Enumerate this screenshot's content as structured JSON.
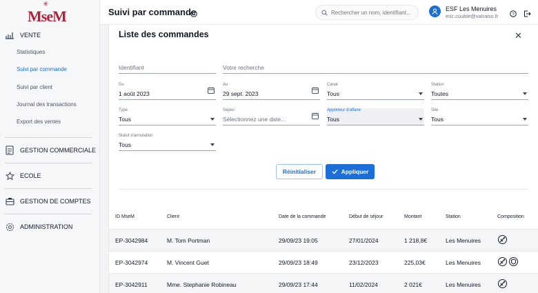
{
  "brand": {
    "logo_text": "MseM",
    "color": "#b3203a"
  },
  "accent": "#1d6fd8",
  "sidebar": {
    "sections": [
      {
        "label": "VENTE",
        "icon": "chart-icon"
      },
      {
        "label": "GESTION COMMERCIALE",
        "icon": "document-icon"
      },
      {
        "label": "ECOLE",
        "icon": "star-icon"
      },
      {
        "label": "GESTION DE COMPTES",
        "icon": "briefcase-icon"
      },
      {
        "label": "ADMINISTRATION",
        "icon": "gear-icon"
      }
    ],
    "vente_items": [
      {
        "label": "Statistiques",
        "active": false
      },
      {
        "label": "Suivi par commande",
        "active": true
      },
      {
        "label": "Suivi par client",
        "active": false
      },
      {
        "label": "Journal des transactions",
        "active": false
      },
      {
        "label": "Export des ventes",
        "active": false
      }
    ]
  },
  "header": {
    "title": "Suivi par commande",
    "search_placeholder": "Rechercher un nom, identifiant...",
    "user_name": "ESF Les Menuires",
    "user_email": "eric.couble@valraiso.fr"
  },
  "panel": {
    "title": "Liste des commandes",
    "filters": {
      "identifiant": "Identifiant",
      "recherche": "Votre recherche",
      "du_label": "Du",
      "du_value": "1 août 2023",
      "au_label": "Au",
      "au_value": "29 sept. 2023",
      "canal_label": "Canal",
      "canal_value": "Tous",
      "station_label": "Station",
      "station_value": "Toutes",
      "type_label": "Type",
      "type_value": "Tous",
      "sejour_label": "Séjour",
      "sejour_placeholder": "Sélectionnez une date...",
      "apporteur_label": "Apporteur d'affaire",
      "apporteur_value": "Tous",
      "site_label": "Site",
      "site_value": "Tous",
      "statut_label": "Statut d'annulation",
      "statut_value": "Tous"
    },
    "reset_label": "Réinitialiser",
    "apply_label": "Appliquer"
  },
  "table": {
    "columns": [
      "ID MseM",
      "Client",
      "Date de la commande",
      "Début de séjour",
      "Montant",
      "Station",
      "Composition"
    ],
    "rows": [
      {
        "id": "EP-3042984",
        "client": "M. Tom Portman",
        "date": "29/09/23 19:05",
        "debut": "27/01/2024",
        "montant": "1 218,8€",
        "station": "Les Menuires",
        "icons": [
          "ski-icon"
        ]
      },
      {
        "id": "EP-3042974",
        "client": "M. Vincent Guet",
        "date": "29/09/23 18:49",
        "debut": "23/12/2023",
        "montant": "225,03€",
        "station": "Les Menuires",
        "icons": [
          "ski-icon",
          "shield-icon"
        ]
      },
      {
        "id": "EP-3042911",
        "client": "Mme. Stephanie Robineau",
        "date": "29/09/23 17:44",
        "debut": "11/02/2024",
        "montant": "2 021€",
        "station": "Les Menuires",
        "icons": [
          "ski-icon"
        ]
      }
    ]
  }
}
